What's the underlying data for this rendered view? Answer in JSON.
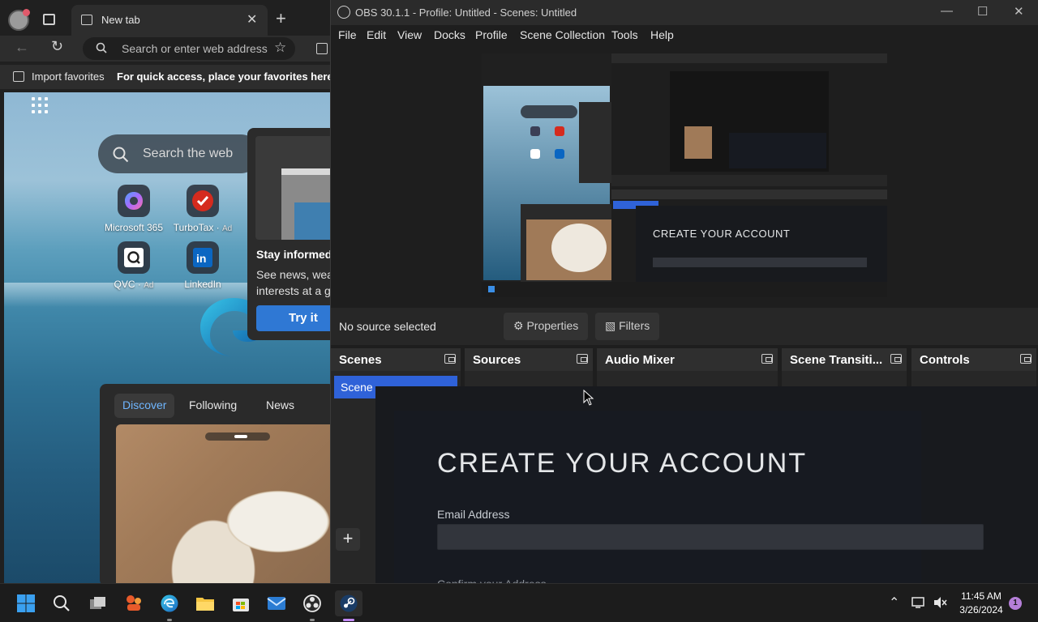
{
  "browser": {
    "tab_title": "New tab",
    "address_placeholder": "Search or enter web address",
    "favorites": {
      "import_label": "Import favorites",
      "hint": "For quick access, place your favorites here on the favorites bar."
    },
    "ntp": {
      "search_placeholder": "Search the web",
      "tiles": [
        {
          "label": "Microsoft 365",
          "ad": ""
        },
        {
          "label": "TurboTax",
          "ad": "Ad"
        },
        {
          "label": "QVC",
          "ad": "Ad"
        },
        {
          "label": "LinkedIn",
          "ad": ""
        }
      ],
      "promo": {
        "title": "Stay informed",
        "body": "See news, weather, and interests at a glance",
        "button": "Try it"
      },
      "feed_tabs": [
        "Discover",
        "Following",
        "News"
      ]
    }
  },
  "obs": {
    "window_title": "OBS 30.1.1 - Profile: Untitled - Scenes: Untitled",
    "menu": [
      "File",
      "Edit",
      "View",
      "Docks",
      "Profile",
      "Scene Collection",
      "Tools",
      "Help"
    ],
    "status": {
      "no_source": "No source selected",
      "properties": "Properties",
      "filters": "Filters"
    },
    "docks": {
      "scenes": "Scenes",
      "sources": "Sources",
      "audio_mixer": "Audio Mixer",
      "scene_transitions": "Scene Transiti...",
      "controls": "Controls"
    },
    "scene_item": "Scene",
    "add_symbol": "+"
  },
  "steam": {
    "heading": "CREATE YOUR ACCOUNT",
    "email_label": "Email Address",
    "next_label": "Confirm your Address"
  },
  "taskbar": {
    "time": "11:45 AM",
    "date": "3/26/2024",
    "notifications": "1"
  }
}
